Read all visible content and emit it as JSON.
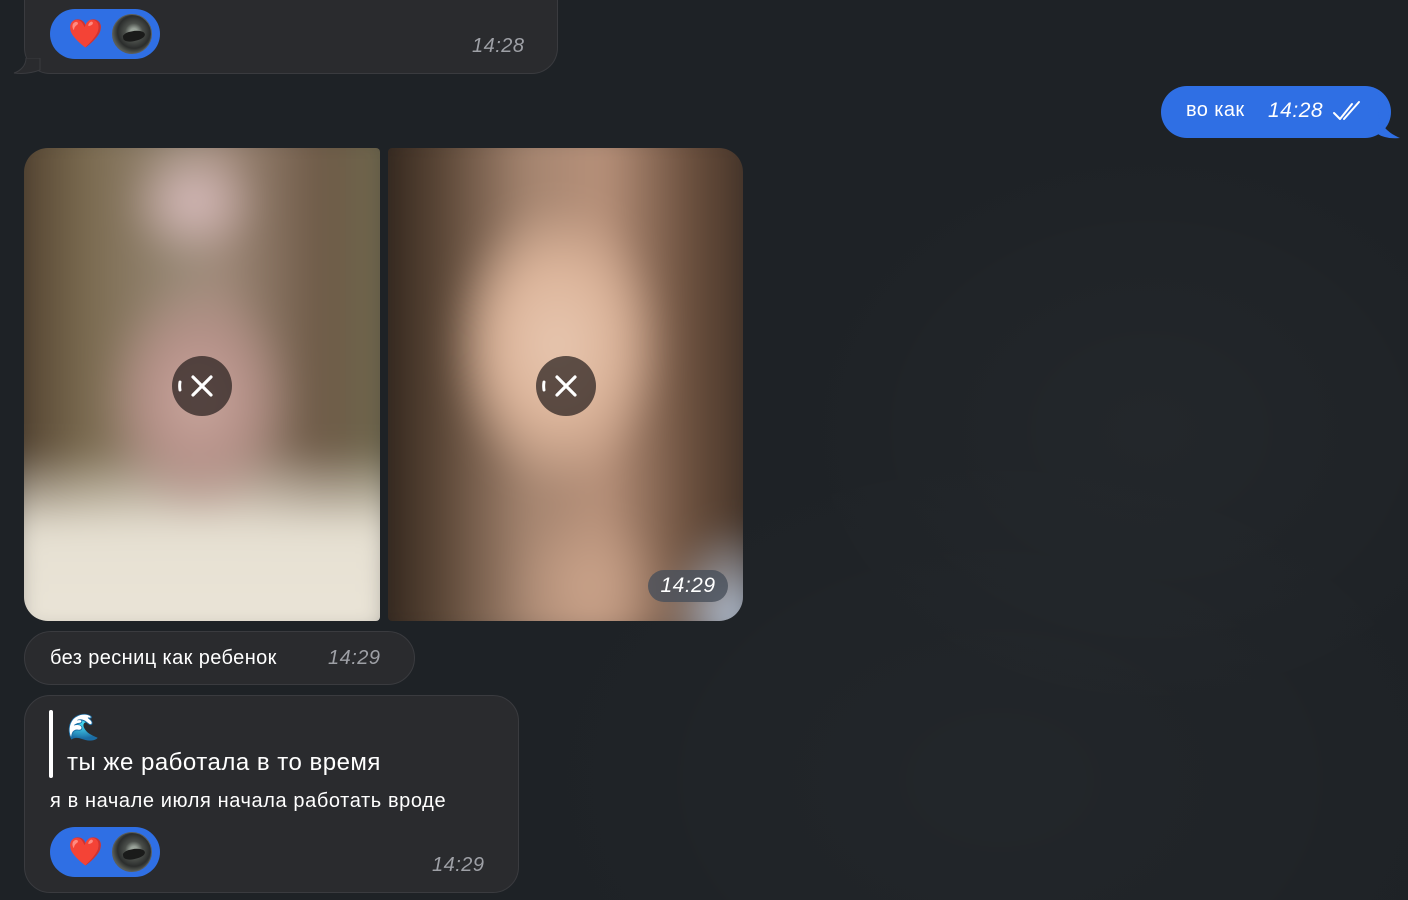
{
  "messages": {
    "top": {
      "time": "14:28",
      "reaction": {
        "emoji": "❤️"
      }
    },
    "outgoing": {
      "text": "во как",
      "time": "14:28",
      "status_icon": "double-check-icon"
    },
    "photos": {
      "time": "14:29",
      "overlay_icon": "close-icon"
    },
    "short": {
      "text": "без ресниц как ребенок",
      "time": "14:29"
    },
    "reply": {
      "quote_emoji": "🌊",
      "quote_text": "ты же работала в то время",
      "text": "я в начале июля начала работать вроде",
      "time": "14:29",
      "reaction": {
        "emoji": "❤️"
      }
    }
  },
  "colors": {
    "background": "#1e2226",
    "incoming_bubble": "#2a2b2e",
    "outgoing_bubble": "#2f6fe4",
    "reaction_pill": "#2f6fe4",
    "heart": "#ff3b41"
  }
}
